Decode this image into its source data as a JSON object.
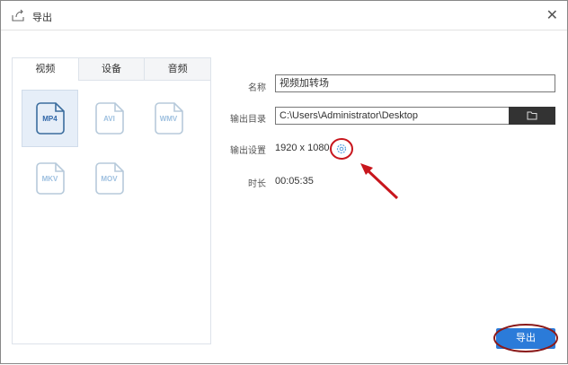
{
  "window": {
    "title": "导出",
    "close_icon": "close-icon"
  },
  "tabs": [
    {
      "label": "视频"
    },
    {
      "label": "设备"
    },
    {
      "label": "音频"
    }
  ],
  "formats": [
    {
      "label": "MP4",
      "selected": true
    },
    {
      "label": "AVI"
    },
    {
      "label": "WMV"
    },
    {
      "label": "MKV"
    },
    {
      "label": "MOV"
    }
  ],
  "form": {
    "name_label": "名称",
    "name_value": "视频加转场",
    "dir_label": "输出目录",
    "dir_value": "C:\\Users\\Administrator\\Desktop",
    "settings_label": "输出设置",
    "settings_value": "1920 x 1080",
    "duration_label": "时长",
    "duration_value": "00:05:35"
  },
  "export_label": "导出",
  "colors": {
    "accent": "#2b7bd9",
    "annotation": "#c8161d"
  }
}
